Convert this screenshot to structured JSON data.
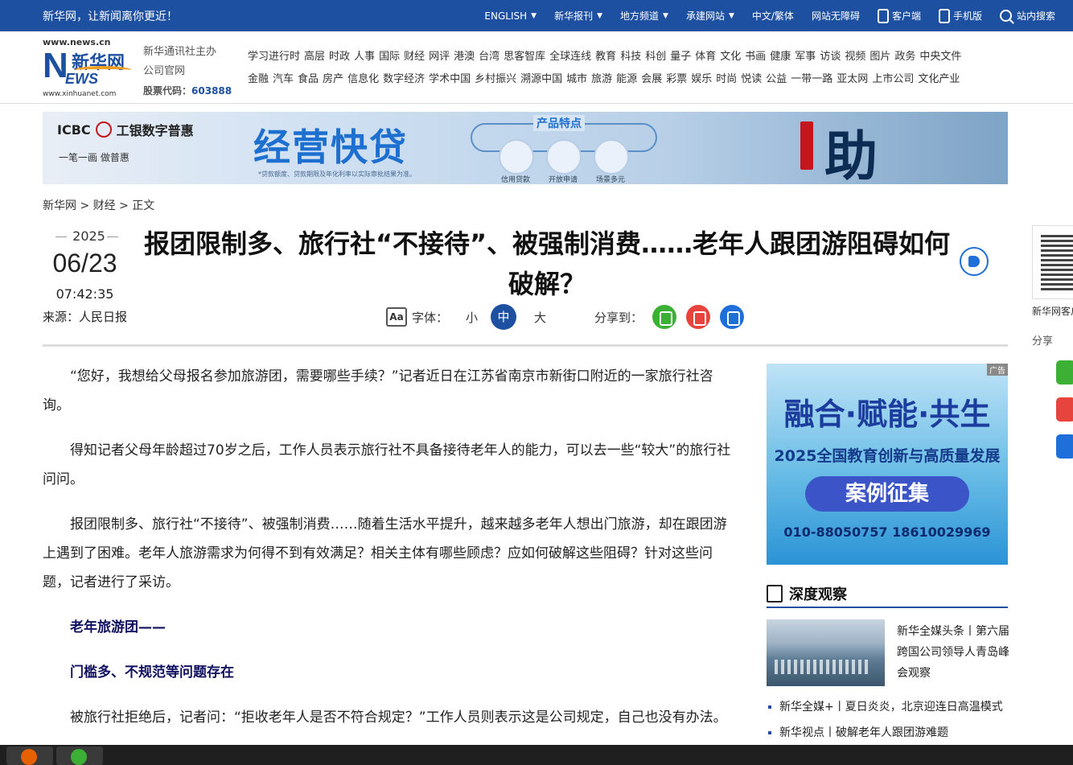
{
  "topbar": {
    "slogan": "新华网，让新闻离你更近！",
    "items": [
      {
        "label": "ENGLISH",
        "dropdown": true
      },
      {
        "label": "新华报刊",
        "dropdown": true
      },
      {
        "label": "地方频道",
        "dropdown": true
      },
      {
        "label": "承建网站",
        "dropdown": true
      },
      {
        "label": "中文/繁体",
        "dropdown": false
      },
      {
        "label": "网站无障碍",
        "dropdown": false
      },
      {
        "label": "客户端",
        "icon": "phone-icon"
      },
      {
        "label": "手机版",
        "icon": "phone-icon"
      },
      {
        "label": "站内搜索",
        "icon": "search-icon"
      }
    ]
  },
  "header": {
    "logo": {
      "url_top": "www.news.cn",
      "cn": "新华网",
      "url_bottom": "www.xinhuanet.com"
    },
    "org_line1": "新华通讯社主办",
    "org_line2": "公司官网",
    "stock_label": "股票代码：",
    "stock_code": "603888",
    "channels_row1": [
      "学习进行时",
      "高层",
      "时政",
      "人事",
      "国际",
      "财经",
      "网评",
      "港澳",
      "台湾",
      "思客智库",
      "全球连线",
      "教育",
      "科技",
      "科创",
      "量子",
      "体育",
      "文化",
      "书画",
      "健康",
      "军事",
      "访谈",
      "视频",
      "图片",
      "政务",
      "中央文件"
    ],
    "channels_row2": [
      "金融",
      "汽车",
      "食品",
      "房产",
      "信息化",
      "数字经济",
      "学术中国",
      "乡村振兴",
      "溯源中国",
      "城市",
      "旅游",
      "能源",
      "会展",
      "彩票",
      "娱乐",
      "时尚",
      "悦读",
      "公益",
      "一带一路",
      "亚太网",
      "上市公司",
      "文化产业"
    ]
  },
  "banner": {
    "brand": "ICBC",
    "brand_cn": "工银数字普惠",
    "slogan": "一笔一画 做普惠",
    "title": "经营快贷",
    "fine_print": "*贷款额度、贷款期限及年化利率以实际审批结果为准。",
    "feature_title": "产品特点",
    "features": [
      "信用贷款",
      "开放申请",
      "场景多元"
    ],
    "big_char": "助"
  },
  "breadcrumb": {
    "home": "新华网",
    "section": "财经",
    "current": "正文",
    "sep": ">"
  },
  "date": {
    "year": "2025",
    "monthday": "06/23",
    "time": "07:42:35",
    "source": "来源：人民日报"
  },
  "article": {
    "title": "报团限制多、旅行社“不接待”、被强制消费……老年人跟团游阻碍如何破解？",
    "font_label": "字体：",
    "font_small": "小",
    "font_medium": "中",
    "font_large": "大",
    "share_label": "分享到：",
    "paragraphs": [
      "“您好，我想给父母报名参加旅游团，需要哪些手续？”记者近日在江苏省南京市新街口附近的一家旅行社咨询。",
      "得知记者父母年龄超过70岁之后，工作人员表示旅行社不具备接待老年人的能力，可以去一些“较大”的旅行社问问。",
      "报团限制多、旅行社“不接待”、被强制消费……随着生活水平提升，越来越多老年人想出门旅游，却在跟团游上遇到了困难。老年人旅游需求为何得不到有效满足？相关主体有哪些顾虑？应如何破解这些阻碍？针对这些问题，记者进行了采访。",
      "老年旅游团——",
      "门槛多、不规范等问题存在",
      "被旅行社拒绝后，记者问：“拒收老年人是否不符合规定？”工作人员则表示这是公司规定，自己也没有办法。"
    ]
  },
  "ad": {
    "tag": "广告",
    "headline": "融合·赋能·共生",
    "subhead": "2025全国教育创新与高质量发展",
    "button": "案例征集",
    "phones": "010-88050757  18610029969"
  },
  "deep": {
    "title": "深度观察",
    "feature_text": "新华全媒头条丨第六届跨国公司领导人青岛峰会观察",
    "list": [
      "新华全媒+丨夏日炎炎，北京迎连日高温模式",
      "新华视点丨破解老年人跟团游难题"
    ]
  },
  "float": {
    "qr_label": "新华网客户端",
    "share_label": "分享"
  }
}
